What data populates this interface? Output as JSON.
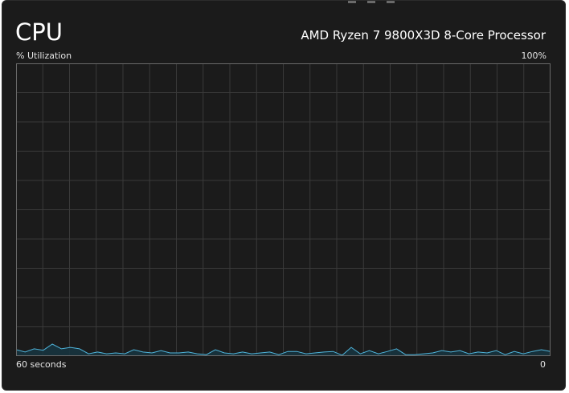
{
  "window": {
    "title": "CPU",
    "processor_name": "AMD Ryzen 7 9800X3D 8-Core Processor"
  },
  "graph": {
    "y_label": "% Utilization",
    "y_max_label": "100%",
    "x_left_label": "60 seconds",
    "x_right_label": "0"
  },
  "colors": {
    "background": "#1b1b1b",
    "grid": "#3a3a3a",
    "line": "#4fb3d9",
    "fill": "#17343f"
  },
  "chart_data": {
    "type": "area",
    "ylim": [
      0,
      100
    ],
    "xlim": [
      60,
      0
    ],
    "grid": true,
    "series": [
      {
        "values": [
          2.2,
          1.4,
          2.5,
          2.0,
          4.1,
          2.5,
          3.0,
          2.5,
          0.8,
          1.4,
          0.8,
          1.1,
          0.8,
          2.2,
          1.4,
          1.1,
          1.9,
          1.1,
          1.1,
          1.4,
          0.8,
          0.5,
          2.2,
          1.1,
          0.8,
          1.4,
          0.8,
          1.1,
          1.4,
          0.5,
          1.6,
          1.6,
          0.8,
          1.1,
          1.4,
          1.6,
          0.3,
          3.0,
          0.8,
          1.9,
          0.8,
          1.6,
          2.5,
          0.5,
          0.5,
          0.8,
          1.1,
          1.9,
          1.4,
          1.9,
          0.8,
          1.4,
          1.1,
          1.9,
          0.5,
          1.6,
          0.8,
          1.6,
          2.2,
          1.6
        ]
      }
    ]
  }
}
